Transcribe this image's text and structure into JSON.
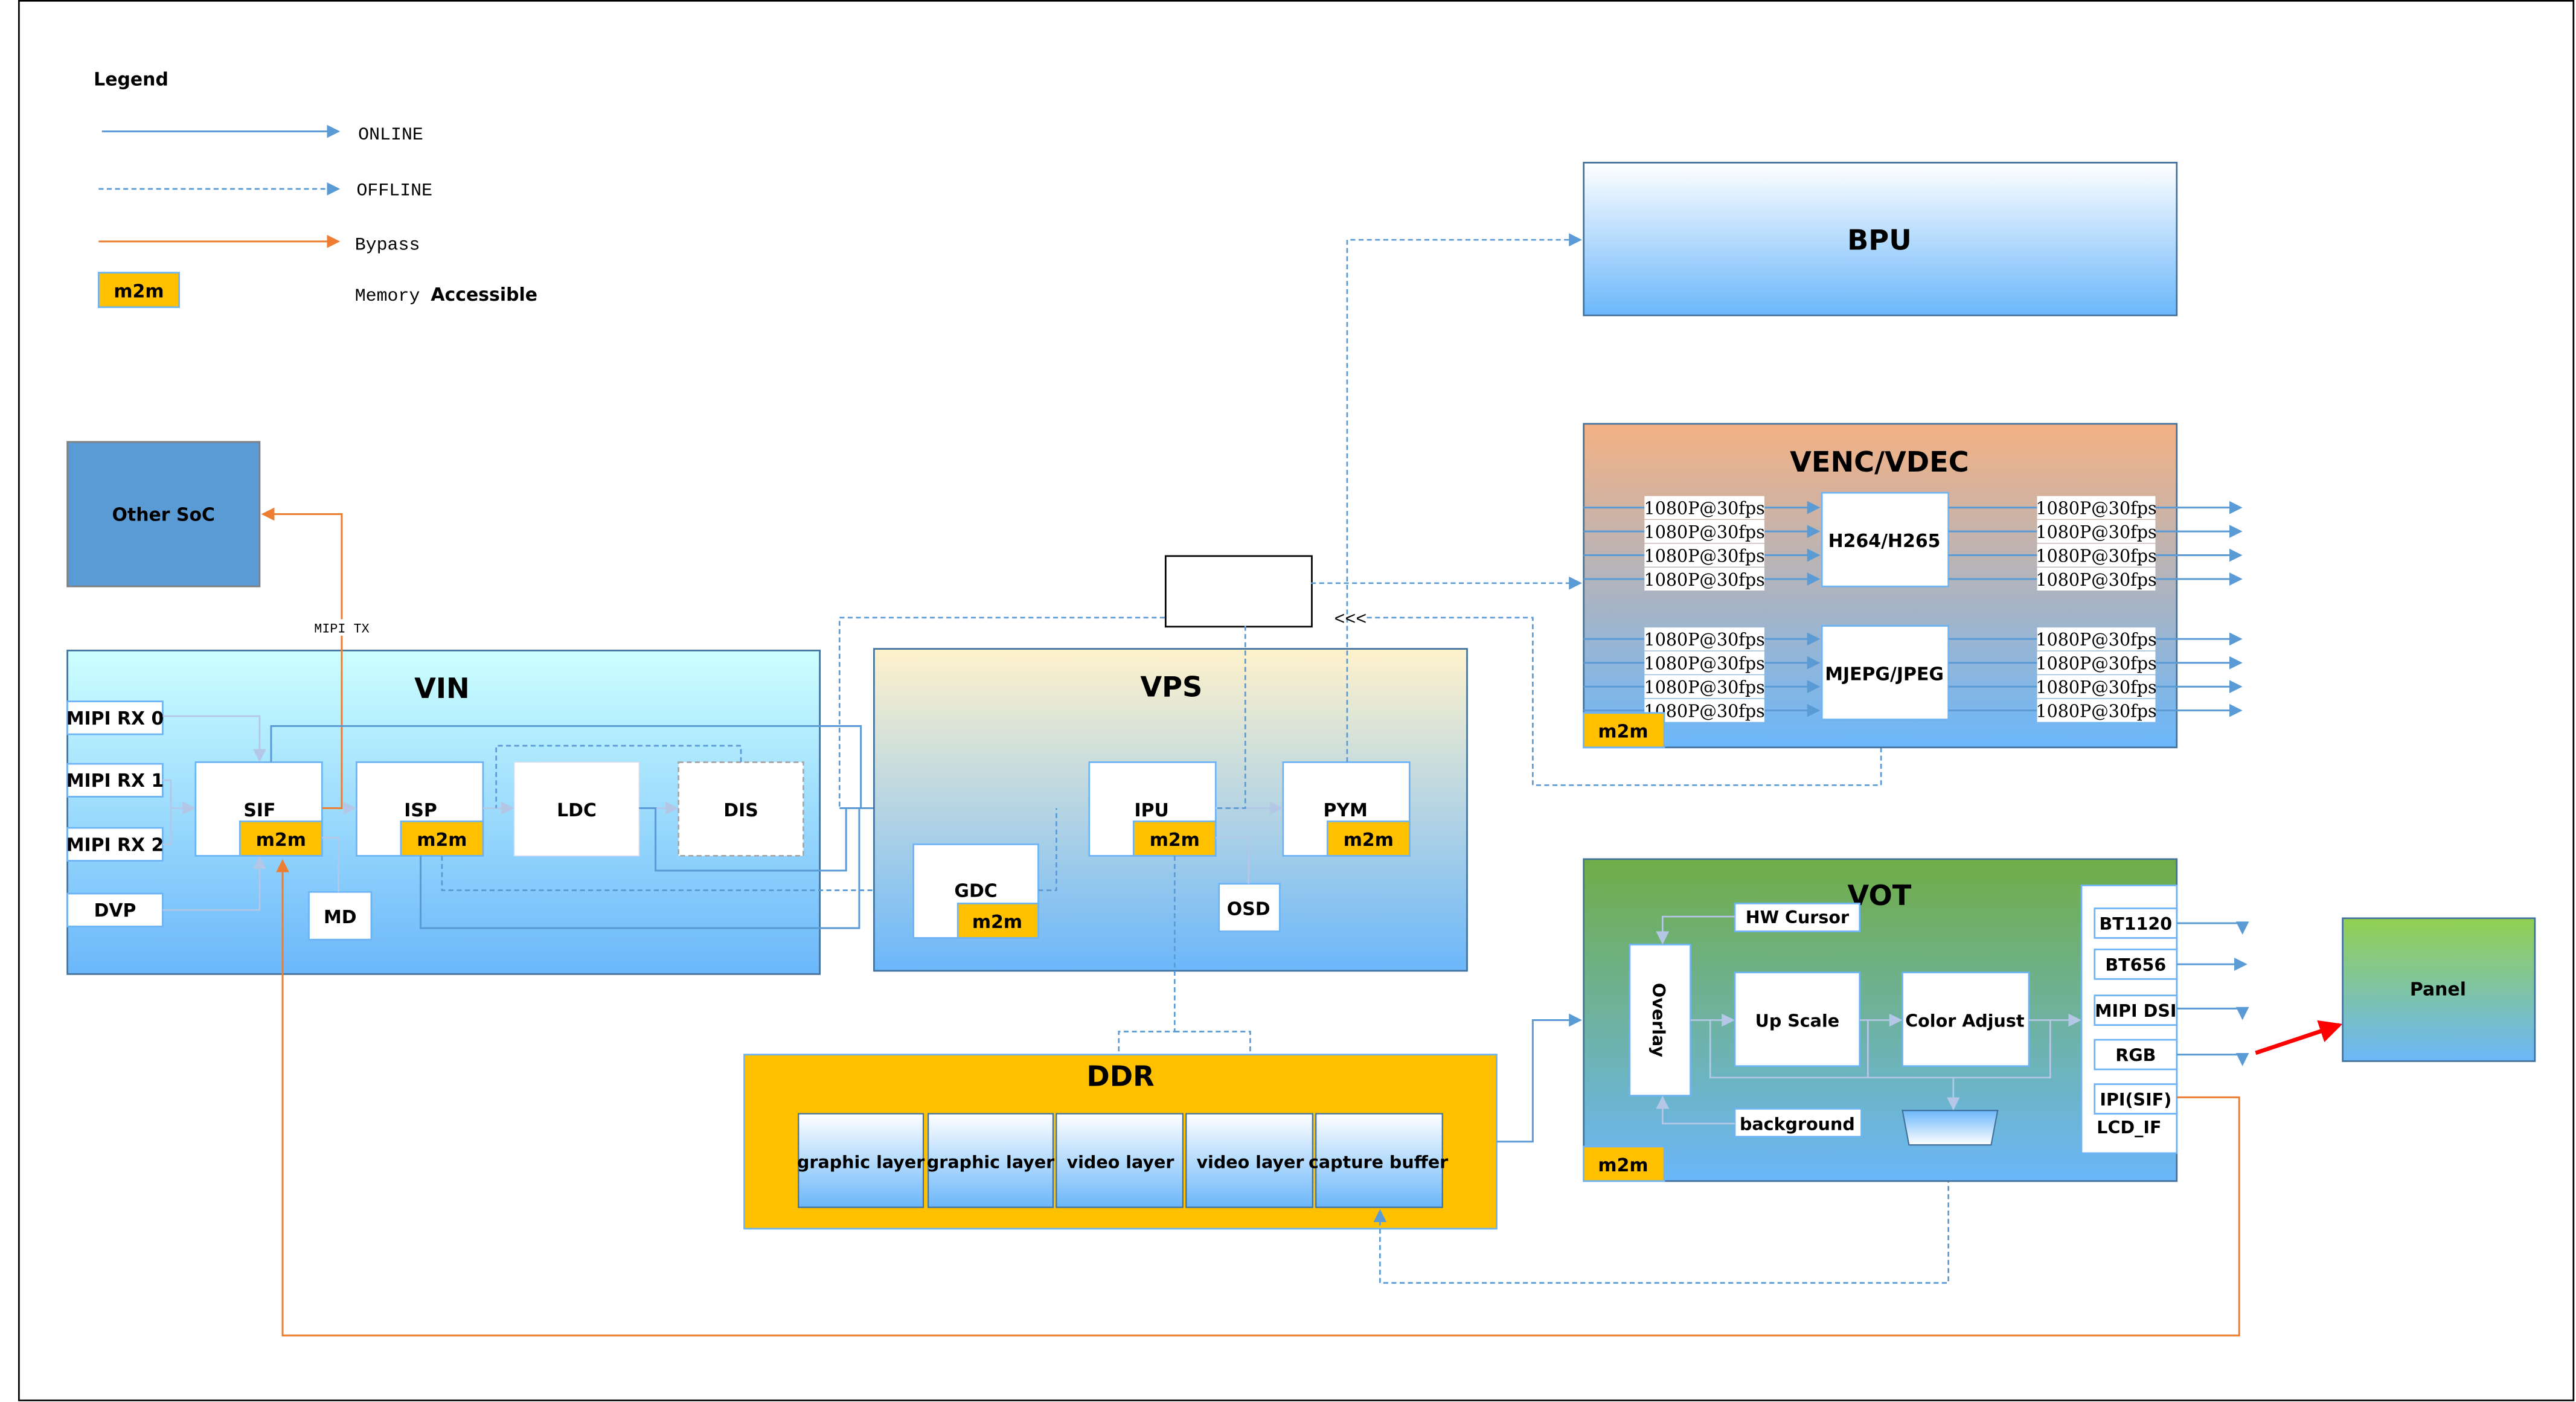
{
  "legend": {
    "title": "Legend",
    "items": [
      {
        "label": "ONLINE",
        "style": "solid",
        "color": "#5b9bd5"
      },
      {
        "label": "OFFLINE",
        "style": "dashed",
        "color": "#5b9bd5"
      },
      {
        "label": "Bypass",
        "style": "solid",
        "color": "#ed7d31"
      },
      {
        "label_prefix": "Memory ",
        "label_suffix": "Accessible",
        "swatch_text": "m2m",
        "color": "#ffc000"
      }
    ]
  },
  "colors": {
    "online": "#5b9bd5",
    "bypass": "#ed7d31",
    "m2m": "#ffc000",
    "highlight_arrow": "#ff0000"
  },
  "other_soc": {
    "label": "Other SoC"
  },
  "mipi_tx_label": "MIPI TX",
  "vin": {
    "title": "VIN",
    "inputs": [
      "MIPI RX 0",
      "MIPI RX 1",
      "MIPI RX 2",
      "DVP"
    ],
    "modules": [
      {
        "name": "SIF",
        "m2m": "m2m"
      },
      {
        "name": "ISP",
        "m2m": "m2m"
      },
      {
        "name": "LDC"
      },
      {
        "name": "DIS"
      }
    ],
    "md": "MD"
  },
  "vps": {
    "title": "VPS",
    "modules": [
      {
        "name": "IPU",
        "m2m": "m2m"
      },
      {
        "name": "PYM",
        "m2m": "m2m"
      },
      {
        "name": "GDC",
        "m2m": "m2m"
      }
    ],
    "osd": "OSD"
  },
  "bpu": {
    "title": "BPU"
  },
  "venc": {
    "title": "VENC/VDEC",
    "codecs": [
      "H264/H265",
      "MJEPG/JPEG"
    ],
    "stream_label": "1080P@30fps",
    "streams_per_side": 4,
    "m2m": "m2m"
  },
  "ddr": {
    "title": "DDR",
    "buffers": [
      "graphic layer",
      "graphic layer",
      "video layer",
      "video layer",
      "capture buffer"
    ]
  },
  "vot": {
    "title": "VOT",
    "hw_cursor": "HW Cursor",
    "overlay": "Overlay",
    "up_scale": "Up Scale",
    "color_adjust": "Color Adjust",
    "background": "background",
    "m2m": "m2m",
    "interfaces": [
      "BT1120",
      "BT656",
      "MIPI DSI",
      "RGB",
      "IPI(SIF)"
    ],
    "lcd_if": "LCD_IF"
  },
  "panel": {
    "label": "Panel"
  },
  "feedback_marker": "<<<"
}
